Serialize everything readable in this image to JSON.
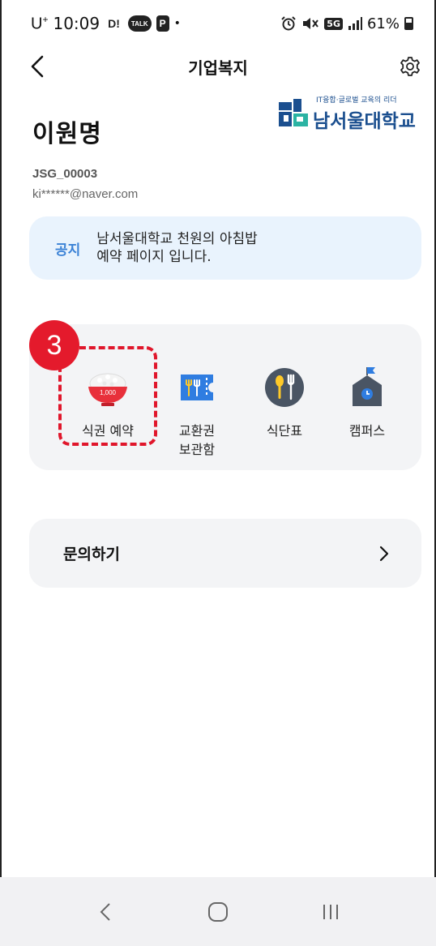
{
  "status_bar": {
    "carrier": "U",
    "carrier_sup": "+",
    "time": "10:09",
    "badge_1": "D!",
    "badge_2": "TALK",
    "badge_3": "P",
    "dot": "•",
    "network": "5G",
    "battery": "61%"
  },
  "header": {
    "title": "기업복지"
  },
  "profile": {
    "name": "이원명",
    "id": "JSG_00003",
    "email": "ki******@naver.com"
  },
  "logo": {
    "tagline": "IT융합·글로벌 교육의 리더",
    "name": "남서울대학교"
  },
  "notice": {
    "label": "공지",
    "text": "남서울대학교 천원의 아침밥\n예약 페이지 입니다."
  },
  "menu": {
    "items": [
      {
        "label": "식권 예약",
        "icon": "rice-bowl-icon",
        "icon_text": "1,000"
      },
      {
        "label": "교환권\n보관함",
        "icon": "voucher-icon"
      },
      {
        "label": "식단표",
        "icon": "meal-plan-icon"
      },
      {
        "label": "캠퍼스",
        "icon": "campus-icon"
      }
    ]
  },
  "annotation": {
    "step": "3"
  },
  "inquiry": {
    "label": "문의하기"
  },
  "colors": {
    "accent": "#3b82d6",
    "highlight": "#e0162b",
    "card": "#f3f4f6",
    "notice_bg": "#e9f3fd",
    "icon_dark": "#4a5564",
    "icon_blue": "#2f7de1",
    "icon_yellow": "#ffc928",
    "logo": "#1b4f8f"
  }
}
